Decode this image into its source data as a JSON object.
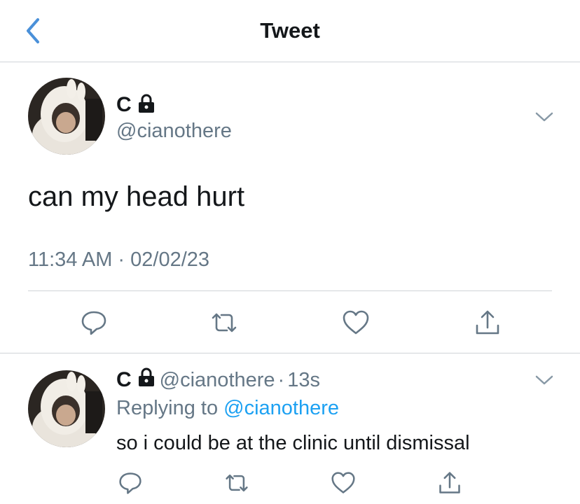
{
  "nav": {
    "title": "Tweet",
    "back_icon": "chevron-left-icon"
  },
  "tweet": {
    "name": "C",
    "handle": "@cianothere",
    "text": "can my head hurt",
    "timestamp": "11:34 AM · 02/02/23",
    "actions": [
      "reply-icon",
      "retweet-icon",
      "like-icon",
      "share-icon"
    ]
  },
  "reply": {
    "name": "C",
    "handle": "@cianothere",
    "dot": "·",
    "time": "13s",
    "replying_prefix": "Replying to",
    "replying_mention": "@cianothere",
    "text": "so i could be at the clinic until dismissal",
    "actions": [
      "reply-icon",
      "retweet-icon",
      "like-icon",
      "share-icon"
    ]
  },
  "colors": {
    "accent": "#1da1f2",
    "text": "#14171a",
    "secondary": "#657786",
    "divider": "#d0d4d8",
    "back": "#4a90d9"
  }
}
